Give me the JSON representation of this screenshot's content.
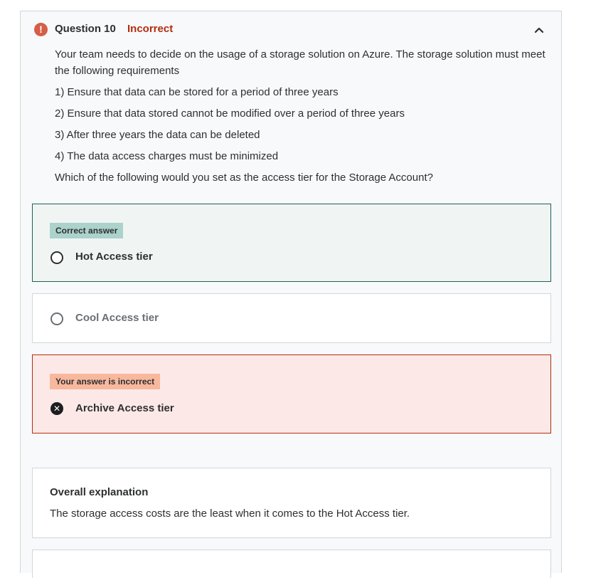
{
  "question": {
    "title": "Question 10",
    "status": "Incorrect",
    "status_color": "#b32d0f",
    "icons": {
      "status": "alert-circle-icon",
      "toggle": "chevron-up-icon"
    },
    "lines": [
      "Your team needs to decide on the usage of a storage solution on Azure. The storage solution must meet the following requirements",
      "1) Ensure that data can be stored for a period of three years",
      "2) Ensure that data stored cannot be modified over a period of three years",
      "3) After three years the data can be deleted",
      "4) The data access charges must be minimized",
      "Which of the following would you set as the access tier for the Storage Account?"
    ]
  },
  "options": [
    {
      "tag": "Correct answer",
      "label": "Hot Access tier",
      "state": "correct",
      "border_color": "#1e6055"
    },
    {
      "tag": "",
      "label": "Cool Access tier",
      "state": "neutral"
    },
    {
      "tag": "Your answer is incorrect",
      "label": "Archive Access tier",
      "state": "wrong",
      "border_color": "#b32d0f"
    }
  ],
  "explanation": {
    "title": "Overall explanation",
    "text": "The storage access costs are the least when it comes to the Hot Access tier."
  }
}
